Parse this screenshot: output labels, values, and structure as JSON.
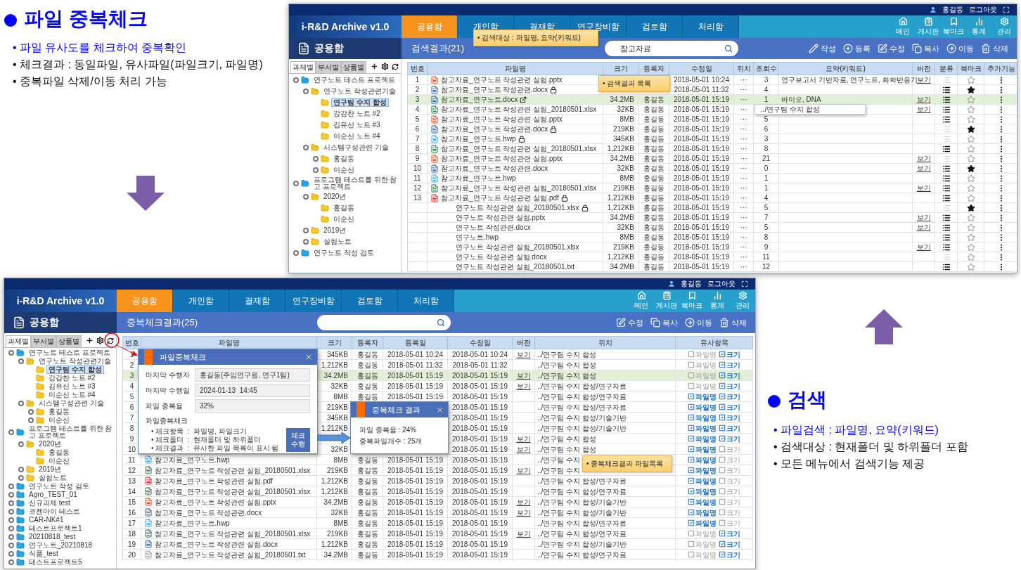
{
  "slide": {
    "sections": [
      {
        "heading": "파일 중복체크",
        "bullets": [
          {
            "text": "• 파일 유사도를 체크하여 중복확인",
            "highlight": true
          },
          {
            "text": "• 체크결과 : 동일파일, 유사파일(파일크기, 파일명)",
            "highlight": false
          },
          {
            "text": "• 중복파일 삭제/이동 처리 가능",
            "highlight": false
          }
        ]
      },
      {
        "heading": "검색",
        "bullets": [
          {
            "text": "• 파일검색 : 파일명, 요약(키워드)",
            "highlight": true
          },
          {
            "text": "• 검색대상 : 현재폴더 및 하위폴더 포함",
            "highlight": false
          },
          {
            "text": "• 모든 메뉴에서 검색기능 제공",
            "highlight": false
          }
        ]
      }
    ]
  },
  "windows": [
    {
      "kind": "search",
      "user": "홍길동",
      "logout": "로그아웃",
      "logo": "i-R&D Archive v1.0",
      "nav": [
        {
          "label": "공용함",
          "selected": true
        },
        {
          "label": "개인함",
          "selected": false
        },
        {
          "label": "결재함",
          "selected": false
        },
        {
          "label": "연구장비함",
          "selected": false
        },
        {
          "label": "검토함",
          "selected": false
        },
        {
          "label": "처리함",
          "selected": false
        }
      ],
      "quick_links": [
        {
          "label": "메인",
          "kind": "home"
        },
        {
          "label": "게시판",
          "kind": "board"
        },
        {
          "label": "북마크",
          "kind": "bookmark"
        },
        {
          "label": "통계",
          "kind": "stats"
        },
        {
          "label": "관리",
          "kind": "admin"
        }
      ],
      "section_title": "공용함",
      "result_title": "검색결과(21)",
      "search": {
        "value": "참고자료"
      },
      "actions": [
        {
          "label": "작성",
          "kind": "write"
        },
        {
          "label": "등록",
          "kind": "add"
        },
        {
          "label": "수정",
          "kind": "edit"
        },
        {
          "label": "복사",
          "kind": "copy"
        },
        {
          "label": "이동",
          "kind": "move"
        },
        {
          "label": "삭제",
          "kind": "delete"
        }
      ],
      "sidebar_tabs": [
        {
          "label": "과제별",
          "selected": true
        },
        {
          "label": "부서별",
          "selected": false
        },
        {
          "label": "상품별",
          "selected": false
        }
      ],
      "tree": [
        {
          "label": "연구노트 테스트 프로젝트",
          "selected": false,
          "expandable": true,
          "children": [
            {
              "label": "연구노트 작성관련기술",
              "selected": false,
              "expandable": true,
              "children": [
                {
                  "label": "연구팀 수지 합성",
                  "selected": true,
                  "expandable": false
                },
                {
                  "label": "강감찬 노트 #2",
                  "selected": false,
                  "expandable": false
                },
                {
                  "label": "김유신 노트 #3",
                  "selected": false,
                  "expandable": false
                },
                {
                  "label": "이순신 노트 #4",
                  "selected": false,
                  "expandable": false
                }
              ]
            },
            {
              "label": "시스템구성관련 기술",
              "selected": false,
              "expandable": true,
              "children": [
                {
                  "label": "홍길동",
                  "selected": false,
                  "expandable": true
                },
                {
                  "label": "이순신",
                  "selected": false,
                  "expandable": true
                }
              ]
            }
          ]
        },
        {
          "label": "프로그램 테스트를 위한 참고 프로젝트",
          "selected": false,
          "expandable": true,
          "children": [
            {
              "label": "2020년",
              "selected": false,
              "expandable": true,
              "children": [
                {
                  "label": "홍길동",
                  "selected": false,
                  "expandable": false
                },
                {
                  "label": "이순신",
                  "selected": false,
                  "expandable": false
                }
              ]
            },
            {
              "label": "2019년",
              "selected": false,
              "expandable": true
            },
            {
              "label": "실험노트",
              "selected": false,
              "expandable": true
            }
          ]
        },
        {
          "label": "연구노트 작성 검토",
          "selected": false,
          "expandable": true
        }
      ],
      "table": {
        "columns": [
          {
            "label": "번호",
            "kind": "no"
          },
          {
            "label": "파일명",
            "kind": "name"
          },
          {
            "label": "크기",
            "kind": "size"
          },
          {
            "label": "등록자",
            "kind": "owner"
          },
          {
            "label": "수정일",
            "kind": "date"
          },
          {
            "label": "위치",
            "kind": "location"
          },
          {
            "label": "조회수",
            "kind": "views"
          },
          {
            "label": "요약(키워드)",
            "kind": "summary"
          },
          {
            "label": "버전",
            "kind": "version"
          },
          {
            "label": "분류",
            "kind": "classified"
          },
          {
            "label": "북마크",
            "kind": "bookmark"
          },
          {
            "label": "추가기능",
            "kind": "more"
          }
        ],
        "rows": [
          {
            "no": "1",
            "kind": "pptx",
            "name": "참고자료_연구노트 작성관련 실험.pptx",
            "locked": false,
            "shared": false,
            "date": "2018-05-01 10:24",
            "location": "···",
            "views": "3",
            "summary": "연구보고서 기반자료, 연구노트, 화학반응기",
            "version": "보기",
            "classified": false,
            "bookmarked": false,
            "selected": false
          },
          {
            "no": "2",
            "kind": "docx",
            "name": "참고자료_연구노트 작성관련.docx",
            "locked": true,
            "shared": false,
            "date": "2018-05-01 11:32",
            "location": "···",
            "views": "4",
            "classified": true,
            "bookmarked": true,
            "selected": false
          },
          {
            "no": "3",
            "kind": "docx",
            "name": "참고자료_연구노트.docx",
            "locked": false,
            "shared": true,
            "size": "34.2MB",
            "owner": "홍길동",
            "date": "2018-05-01 15:19",
            "location": "···",
            "views": "1",
            "summary": "바이오, DNA",
            "version": "보기",
            "classified": true,
            "bookmarked": false,
            "selected": true
          },
          {
            "no": "4",
            "kind": "xlsx",
            "name": "참고자료_연구노트 작성관련 실험_20180501.xlsx",
            "locked": false,
            "shared": false,
            "size": "32KB",
            "owner": "홍길동",
            "date": "2018-05-01 15:19",
            "location": "···",
            "version": "보기",
            "classified": true,
            "bookmarked": false,
            "selected": false
          },
          {
            "no": "5",
            "kind": "pptx",
            "name": "참고자료_연구노트 작성관련 실험.pptx",
            "locked": false,
            "shared": false,
            "size": "8MB",
            "owner": "홍길동",
            "date": "2018-05-01 15:19",
            "location": "···",
            "views": "5",
            "classified": true,
            "bookmarked": false,
            "selected": false
          },
          {
            "no": "6",
            "kind": "docx",
            "name": "참고자료_연구노트 작성관련.docx",
            "locked": true,
            "shared": false,
            "size": "219KB",
            "owner": "홍길동",
            "date": "2018-05-01 15:19",
            "location": "···",
            "views": "6",
            "classified": false,
            "bookmarked": true,
            "selected": false
          },
          {
            "no": "7",
            "kind": "hwp",
            "name": "참고자료_연구노트.hwp",
            "locked": true,
            "shared": false,
            "size": "345KB",
            "owner": "홍길동",
            "date": "2018-05-01 15:19",
            "location": "···",
            "views": "3",
            "classified": false,
            "bookmarked": false,
            "selected": false
          },
          {
            "no": "8",
            "kind": "xlsx",
            "name": "참고자료_연구노트 작성관련 실험_20180501.xlsx",
            "locked": false,
            "shared": false,
            "size": "1,212KB",
            "owner": "홍길동",
            "date": "2018-05-01 15:19",
            "location": "···",
            "views": "8",
            "classified": true,
            "bookmarked": false,
            "selected": false
          },
          {
            "no": "9",
            "kind": "pptx",
            "name": "참고자료_연구노트 작성관련 실험.pptx",
            "locked": false,
            "shared": false,
            "size": "34.2MB",
            "owner": "홍길동",
            "date": "2018-05-01 15:19",
            "location": "···",
            "views": "21",
            "version": "보기",
            "classified": false,
            "bookmarked": false,
            "selected": false
          },
          {
            "no": "10",
            "kind": "docx",
            "name": "참고자료_연구노트 작성관련.docx",
            "locked": false,
            "shared": false,
            "size": "32KB",
            "owner": "홍길동",
            "date": "2018-05-01 15:19",
            "location": "···",
            "views": "0",
            "version": "보기",
            "classified": true,
            "bookmarked": true,
            "selected": false
          },
          {
            "no": "11",
            "kind": "hwp",
            "name": "참고자료_연구노트.hwp",
            "locked": false,
            "shared": false,
            "size": "8MB",
            "owner": "홍길동",
            "date": "2018-05-01 15:19",
            "location": "···",
            "views": "1",
            "classified": true,
            "bookmarked": false,
            "selected": false
          },
          {
            "no": "12",
            "kind": "xlsx",
            "name": "참고자료_연구노트 작성관련 실험_20180501.xlsx",
            "locked": false,
            "shared": false,
            "size": "219KB",
            "owner": "홍길동",
            "date": "2018-05-01 15:19",
            "location": "···",
            "views": "1",
            "version": "보기",
            "classified": true,
            "bookmarked": false,
            "selected": false
          },
          {
            "no": "13",
            "kind": "pdf",
            "name": "참고자료_연구노트 작성관련 실험.pdf",
            "locked": true,
            "shared": false,
            "size": "1,212KB",
            "owner": "홍길동",
            "date": "2018-05-01 15:19",
            "location": "···",
            "views": "4",
            "classified": true,
            "bookmarked": false,
            "selected": false
          },
          {
            "name": "연구노트 작성관련 실험_20180501.xlsx",
            "locked": true,
            "shared": false,
            "size": "1,212KB",
            "owner": "홍길동",
            "date": "2018-05-01 15:19",
            "location": "···",
            "views": "5",
            "classified": false,
            "bookmarked": true,
            "selected": false
          },
          {
            "name": "연구노트 작성관련 실험.pptx",
            "locked": false,
            "shared": false,
            "size": "34.2MB",
            "owner": "홍길동",
            "date": "2018-05-01 15:19",
            "location": "···",
            "views": "7",
            "version": "보기",
            "classified": true,
            "bookmarked": false,
            "selected": false
          },
          {
            "name": "연구노트 작성관련.docx",
            "locked": false,
            "shared": false,
            "size": "32KB",
            "owner": "홍길동",
            "date": "2018-05-01 15:19",
            "location": "···",
            "views": "5",
            "version": "보기",
            "classified": true,
            "bookmarked": false,
            "selected": false
          },
          {
            "name": "연구노트.hwp",
            "locked": false,
            "shared": false,
            "size": "8MB",
            "owner": "홍길동",
            "date": "2018-05-01 15:19",
            "location": "···",
            "views": "8",
            "classified": true,
            "bookmarked": false,
            "selected": false
          },
          {
            "name": "연구노트 작성관련 실험_20180501.xlsx",
            "locked": false,
            "shared": false,
            "size": "219KB",
            "owner": "홍길동",
            "date": "2018-05-01 15:19",
            "location": "···",
            "views": "9",
            "version": "보기",
            "classified": true,
            "bookmarked": false,
            "selected": false
          },
          {
            "name": "연구노트 작성관련 실험.docx",
            "locked": false,
            "shared": false,
            "size": "1,212KB",
            "owner": "홍길동",
            "date": "2018-05-01 15:19",
            "location": "···",
            "views": "11",
            "classified": false,
            "bookmarked": false,
            "selected": false
          },
          {
            "name": "연구노트 작성관련 실험_20180501.txt",
            "locked": false,
            "shared": false,
            "size": "34.2MB",
            "owner": "홍길동",
            "date": "2018-05-01 15:19",
            "location": "···",
            "views": "12",
            "classified": true,
            "bookmarked": false,
            "selected": false
          }
        ]
      },
      "callouts": [
        {
          "text": "• 검색대상 : 파일명, 요약(키워드)"
        },
        {
          "text": "• 검색결과 목록"
        }
      ],
      "path_popup": "../연구팀 수지 합성"
    },
    {
      "kind": "duplicate",
      "user": "홍길동",
      "logout": "로그아웃",
      "logo": "i-R&D Archive v1.0",
      "nav": [
        {
          "label": "공용함",
          "selected": true
        },
        {
          "label": "개인함",
          "selected": false
        },
        {
          "label": "결재함",
          "selected": false
        },
        {
          "label": "연구장비함",
          "selected": false
        },
        {
          "label": "검토함",
          "selected": false
        },
        {
          "label": "처리함",
          "selected": false
        }
      ],
      "quick_links": [
        {
          "label": "메인",
          "kind": "home"
        },
        {
          "label": "게시판",
          "kind": "board"
        },
        {
          "label": "북마크",
          "kind": "bookmark"
        },
        {
          "label": "통계",
          "kind": "stats"
        },
        {
          "label": "관리",
          "kind": "admin"
        }
      ],
      "section_title": "공용함",
      "result_title": "중복체크결과(25)",
      "actions": [
        {
          "label": "수정",
          "kind": "edit"
        },
        {
          "label": "복사",
          "kind": "copy"
        },
        {
          "label": "이동",
          "kind": "move"
        },
        {
          "label": "삭제",
          "kind": "delete"
        }
      ],
      "sidebar_tabs": [
        {
          "label": "과제별",
          "selected": true
        },
        {
          "label": "부서별",
          "selected": false
        },
        {
          "label": "상품별",
          "selected": false
        }
      ],
      "tree": [
        {
          "label": "연구노트 테스트 프로젝트",
          "selected": false,
          "expandable": true,
          "children": [
            {
              "label": "연구노트 작성관련기술",
              "selected": false,
              "expandable": true,
              "children": [
                {
                  "label": "연구팀 수지 합성",
                  "selected": true,
                  "expandable": false
                },
                {
                  "label": "강감찬 노트 #2",
                  "selected": false,
                  "expandable": false
                },
                {
                  "label": "김유신 노트 #3",
                  "selected": false,
                  "expandable": false
                },
                {
                  "label": "이순신 노트 #4",
                  "selected": false,
                  "expandable": false
                }
              ]
            },
            {
              "label": "시스템구성관련 기술",
              "selected": false,
              "expandable": true,
              "children": [
                {
                  "label": "홍길동",
                  "selected": false,
                  "expandable": true
                },
                {
                  "label": "이순신",
                  "selected": false,
                  "expandable": true
                }
              ]
            }
          ]
        },
        {
          "label": "프로그램 테스트를 위한 참고 프로젝트",
          "selected": false,
          "expandable": true,
          "children": [
            {
              "label": "2020년",
              "selected": false,
              "expandable": true,
              "children": [
                {
                  "label": "홍길동",
                  "selected": false,
                  "expandable": false
                },
                {
                  "label": "이순신",
                  "selected": false,
                  "expandable": false
                }
              ]
            },
            {
              "label": "2019년",
              "selected": false,
              "expandable": true
            },
            {
              "label": "실험노트",
              "selected": false,
              "expandable": true
            }
          ]
        },
        {
          "label": "연구노트 작성 검토",
          "selected": false,
          "expandable": true
        },
        {
          "label": "Agro_TEST_01",
          "selected": false,
          "expandable": true
        },
        {
          "label": "신규과제 test",
          "selected": false,
          "expandable": true
        },
        {
          "label": "코젠아이 테스트",
          "selected": false,
          "expandable": true
        },
        {
          "label": "CAR-NK#1",
          "selected": false,
          "expandable": true
        },
        {
          "label": "테스트프로젝트1",
          "selected": false,
          "expandable": true
        },
        {
          "label": "20210818_test",
          "selected": false,
          "expandable": true
        },
        {
          "label": "연구노트_20210818",
          "selected": false,
          "expandable": true
        },
        {
          "label": "식품_test",
          "selected": false,
          "expandable": true
        },
        {
          "label": "테스트프로젝트5",
          "selected": false,
          "expandable": true
        }
      ],
      "table": {
        "columns": [
          {
            "label": "번호",
            "kind": "no"
          },
          {
            "label": "파일명",
            "kind": "name"
          },
          {
            "label": "크기",
            "kind": "size"
          },
          {
            "label": "등록자",
            "kind": "owner"
          },
          {
            "label": "등록일",
            "kind": "registered"
          },
          {
            "label": "수정일",
            "kind": "modified"
          },
          {
            "label": "버전",
            "kind": "version"
          },
          {
            "label": "위치",
            "kind": "location"
          },
          {
            "label": "유사항목",
            "kind": "similar"
          }
        ],
        "rows": [
          {
            "no": "1",
            "size": "345KB",
            "owner": "홍길동",
            "registered": "2018-05-01 10:24",
            "modified": "2018-05-01 10:24",
            "version": "보기",
            "location": "../연구팀 수지 합성",
            "similar": [
              {
                "label": "파일명",
                "checked": false
              },
              {
                "label": "크기",
                "checked": true
              }
            ],
            "selected": false
          },
          {
            "no": "2",
            "size": "1,212KB",
            "owner": "홍길동",
            "registered": "2018-05-01 11:32",
            "modified": "2018-05-01 11:32",
            "location": "../연구팀 수지 합성",
            "similar": [
              {
                "label": "파일명",
                "checked": false
              },
              {
                "label": "크기",
                "checked": true
              }
            ],
            "selected": false
          },
          {
            "no": "3",
            "size": "34.2MB",
            "owner": "홍길동",
            "registered": "2018-05-01 15:19",
            "modified": "2018-05-01 15:19",
            "version": "보기",
            "location": "../연구팀 수지 합성",
            "similar": [
              {
                "label": "파일명",
                "checked": false
              },
              {
                "label": "크기",
                "checked": true
              }
            ],
            "selected": true
          },
          {
            "no": "4",
            "size": "32KB",
            "owner": "홍길동",
            "registered": "2018-05-01 15:19",
            "modified": "2018-05-01 15:19",
            "version": "보기",
            "location": "../연구팀 수지 합성/연구자료",
            "similar": [
              {
                "label": "파일명",
                "checked": false
              },
              {
                "label": "크기",
                "checked": true
              }
            ],
            "selected": false
          },
          {
            "no": "5",
            "size": "8MB",
            "owner": "홍길동",
            "registered": "2018-05-01 15:19",
            "modified": "2018-05-01 15:19",
            "location": "../연구팀 수지 합성/연구자료",
            "similar": [
              {
                "label": "파일명",
                "checked": true
              },
              {
                "label": "크기",
                "checked": true
              }
            ],
            "selected": false
          },
          {
            "no": "6",
            "size": "219KB",
            "modified": "2018-05-01 15:19",
            "location": "../연구팀 수지 합성/연구자료",
            "similar": [
              {
                "label": "파일명",
                "checked": true
              },
              {
                "label": "크기",
                "checked": true
              }
            ],
            "selected": false
          },
          {
            "no": "7",
            "size": "345KB",
            "modified": "2018-05-01 15:19",
            "location": "../연구팀 수지 합성/기술기반",
            "similar": [
              {
                "label": "파일명",
                "checked": true
              },
              {
                "label": "크기",
                "checked": true
              }
            ],
            "selected": false
          },
          {
            "no": "8",
            "size": "1,212KB",
            "modified": "2018-05-01 15:19",
            "location": "../연구팀 수지 합성/기술기반",
            "similar": [
              {
                "label": "파일명",
                "checked": true
              },
              {
                "label": "크기",
                "checked": true
              }
            ],
            "selected": false
          },
          {
            "no": "9",
            "modified": "2018-05-01 15:19",
            "version": "보기",
            "location": "../연구팀 수지 합성",
            "similar": [
              {
                "label": "파일명",
                "checked": true
              },
              {
                "label": "크기",
                "checked": true
              }
            ],
            "selected": false
          },
          {
            "no": "10",
            "size": "32KB",
            "modified": "2018-05-01 15:19",
            "version": "보기",
            "location": "../연구팀 수지 합성",
            "similar": [
              {
                "label": "파일명",
                "checked": true
              },
              {
                "label": "크기",
                "checked": false
              }
            ],
            "selected": false
          },
          {
            "no": "11",
            "kind": "hwp",
            "name": "참고자료_연구노트.hwp",
            "size": "8MB",
            "owner": "홍길동",
            "registered": "2018-05-01 15:19",
            "modified": "2018-05-01 15:19",
            "location": "../연구팀 수지",
            "similar": [
              {
                "label": "파일명",
                "checked": true
              },
              {
                "label": "크기",
                "checked": false
              }
            ],
            "selected": false
          },
          {
            "no": "12",
            "kind": "xlsx",
            "name": "참고자료_연구노트 작성관련 실험_20180501.xlsx",
            "size": "219KB",
            "owner": "홍길동",
            "registered": "2018-05-01 15:19",
            "modified": "2018-05-01 15:19",
            "version": "보기",
            "location": "../연구팀 수지",
            "similar": [
              {
                "label": "파일명",
                "checked": true
              },
              {
                "label": "크기",
                "checked": false
              }
            ],
            "selected": false
          },
          {
            "no": "13",
            "kind": "pdf",
            "name": "참고자료_연구노트 작성관련 실험.pdf",
            "size": "1,212KB",
            "owner": "홍길동",
            "registered": "2018-05-01 15:19",
            "modified": "2018-05-01 15:19",
            "location": "../연구팀 수지 합성/연구자료",
            "similar": [
              {
                "label": "파일명",
                "checked": true
              },
              {
                "label": "크기",
                "checked": false
              }
            ],
            "selected": false
          },
          {
            "no": "14",
            "kind": "xlsx",
            "name": "참고자료_연구노트 작성관련 실험_20180501.xlsx",
            "size": "1,212KB",
            "owner": "홍길동",
            "registered": "2018-05-01 15:19",
            "modified": "2018-05-01 15:19",
            "location": "../연구팀 수지 합성/연구자료",
            "similar": [
              {
                "label": "파일명",
                "checked": true
              },
              {
                "label": "크기",
                "checked": false
              }
            ],
            "selected": false
          },
          {
            "no": "15",
            "kind": "pptx",
            "name": "참고자료_연구노트 작성관련 실험.pptx",
            "size": "34.2MB",
            "owner": "홍길동",
            "registered": "2018-05-01 15:19",
            "modified": "2018-05-01 15:19",
            "version": "보기",
            "location": "../연구팀 수지 합성/기술기반",
            "similar": [
              {
                "label": "파일명",
                "checked": true
              },
              {
                "label": "크기",
                "checked": false
              }
            ],
            "selected": false
          },
          {
            "no": "16",
            "kind": "docx",
            "name": "참고자료_연구노트 작성관련.docx",
            "size": "32KB",
            "owner": "홍길동",
            "registered": "2018-05-01 15:19",
            "modified": "2018-05-01 15:19",
            "version": "보기",
            "location": "../연구팀 수지 합성/기술기반",
            "similar": [
              {
                "label": "파일명",
                "checked": true
              },
              {
                "label": "크기",
                "checked": false
              }
            ],
            "selected": false
          },
          {
            "no": "17",
            "kind": "hwp",
            "name": "참고자료_연구노트.hwp",
            "size": "8MB",
            "owner": "홍길동",
            "registered": "2018-05-01 15:19",
            "modified": "2018-05-01 15:19",
            "location": "../연구팀 수지 합성/연구자료",
            "similar": [
              {
                "label": "파일명",
                "checked": true
              },
              {
                "label": "크기",
                "checked": false
              }
            ],
            "selected": false
          },
          {
            "no": "18",
            "kind": "xlsx",
            "name": "참고자료_연구노트 작성관련 실험_20180501.xlsx",
            "size": "219KB",
            "owner": "홍길동",
            "registered": "2018-05-01 15:19",
            "modified": "2018-05-01 15:19",
            "version": "보기",
            "location": "../연구팀 수지 합성/연구자료",
            "similar": [
              {
                "label": "파일명",
                "checked": false
              },
              {
                "label": "크기",
                "checked": true
              }
            ],
            "selected": false
          },
          {
            "no": "19",
            "kind": "docx",
            "name": "참고자료_연구노트 작성관련 실험.docx",
            "size": "1,212KB",
            "owner": "홍길동",
            "registered": "2018-05-01 15:19",
            "modified": "2018-05-01 15:19",
            "location": "../연구팀 수지 합성/기술기반",
            "similar": [
              {
                "label": "파일명",
                "checked": false
              },
              {
                "label": "크기",
                "checked": true
              }
            ],
            "selected": false
          },
          {
            "no": "20",
            "kind": "txt",
            "name": "참고자료_연구노트 작성관련 실험_20180501.txt",
            "size": "34.2MB",
            "owner": "홍길동",
            "registered": "2018-05-01 15:19",
            "modified": "2018-05-01 15:19",
            "location": "../연구팀 수지 합성/연구자료",
            "similar": [
              {
                "label": "파일명",
                "checked": false
              },
              {
                "label": "크기",
                "checked": true
              }
            ],
            "selected": false
          }
        ]
      },
      "callouts": [
        {
          "text": "• 중복체크결과 파일목록"
        }
      ],
      "check_dialog": {
        "title": "파일중복체크",
        "fields": [
          {
            "label": "마지막 수행자",
            "value": "홍길동(주임연구원, 연구1팀)"
          },
          {
            "label": "마지막 수행일",
            "value": "2024-01-13  14:45"
          },
          {
            "label": "파일 중복율",
            "value": "32%"
          }
        ],
        "section_title": "파일중복체크",
        "items": [
          "• 체크항목  :  파일명, 파일크기",
          "• 체크폴더  :  현재폴더 및 하위폴더",
          "• 체크결과  :  유사한 파일 목록이 표시 됨"
        ],
        "button": "체크 수행"
      },
      "result_dialog": {
        "title": "중복체크 결과",
        "lines": [
          "파일 중복율 : 24%",
          "중복파일개수 : 25개"
        ]
      }
    }
  ]
}
